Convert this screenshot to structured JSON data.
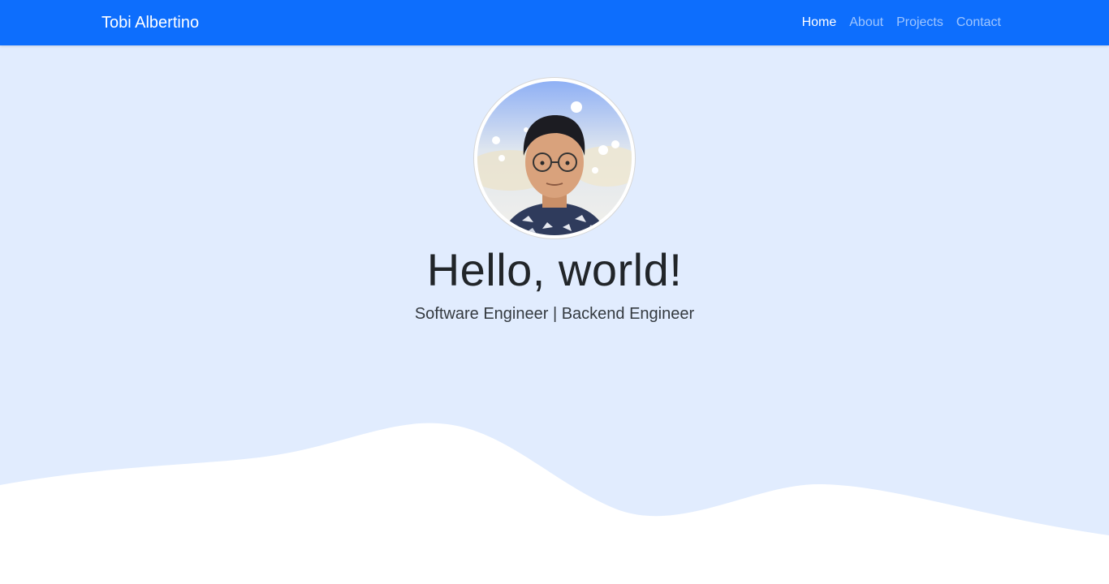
{
  "navbar": {
    "brand": "Tobi Albertino",
    "links": [
      {
        "label": "Home",
        "active": true
      },
      {
        "label": "About",
        "active": false
      },
      {
        "label": "Projects",
        "active": false
      },
      {
        "label": "Contact",
        "active": false
      }
    ]
  },
  "hero": {
    "title": "Hello, world!",
    "subtitle": "Software Engineer | Backend Engineer",
    "avatar_icon": "profile-photo"
  },
  "colors": {
    "navbar_bg": "#0d6efd",
    "hero_bg": "#e1ecfe",
    "wave": "#ffffff",
    "nav_inactive": "rgba(255,255,255,0.6)"
  }
}
